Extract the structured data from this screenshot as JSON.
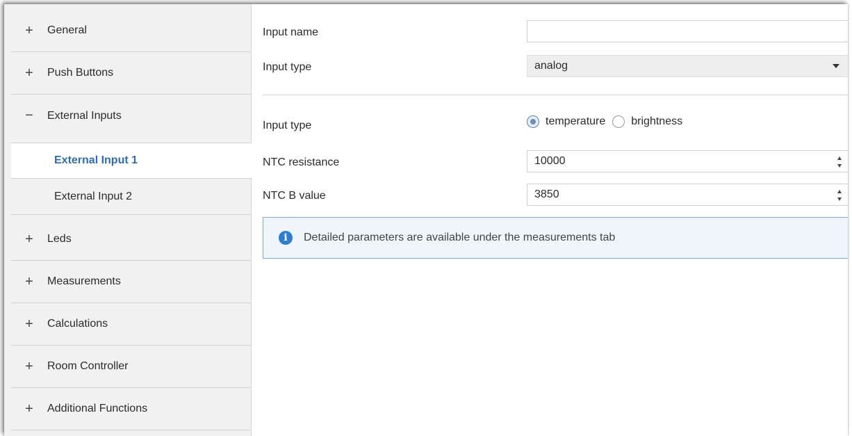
{
  "sidebar": {
    "items": [
      {
        "sign": "+",
        "label": "General"
      },
      {
        "sign": "+",
        "label": "Push Buttons"
      },
      {
        "sign": "−",
        "label": "External Inputs"
      },
      {
        "sign": "+",
        "label": "Leds"
      },
      {
        "sign": "+",
        "label": "Measurements"
      },
      {
        "sign": "+",
        "label": "Calculations"
      },
      {
        "sign": "+",
        "label": "Room Controller"
      },
      {
        "sign": "+",
        "label": "Additional Functions"
      }
    ],
    "subitems": [
      {
        "label": "External Input 1",
        "active": true
      },
      {
        "label": "External Input 2",
        "active": false
      }
    ]
  },
  "form": {
    "input_name": {
      "label": "Input name",
      "value": ""
    },
    "input_type_select": {
      "label": "Input type",
      "value": "analog"
    },
    "input_type_radio": {
      "label": "Input type",
      "options": [
        "temperature",
        "brightness"
      ],
      "selected": "temperature"
    },
    "ntc_resistance": {
      "label": "NTC resistance",
      "value": "10000"
    },
    "ntc_b_value": {
      "label": "NTC B value",
      "value": "3850"
    }
  },
  "info": {
    "icon": "info-icon",
    "text": "Detailed parameters are available under the measurements tab"
  },
  "colors": {
    "accent": "#2f6db3",
    "info_border": "#7ea7d6",
    "info_icon": "#2f7dd1"
  }
}
